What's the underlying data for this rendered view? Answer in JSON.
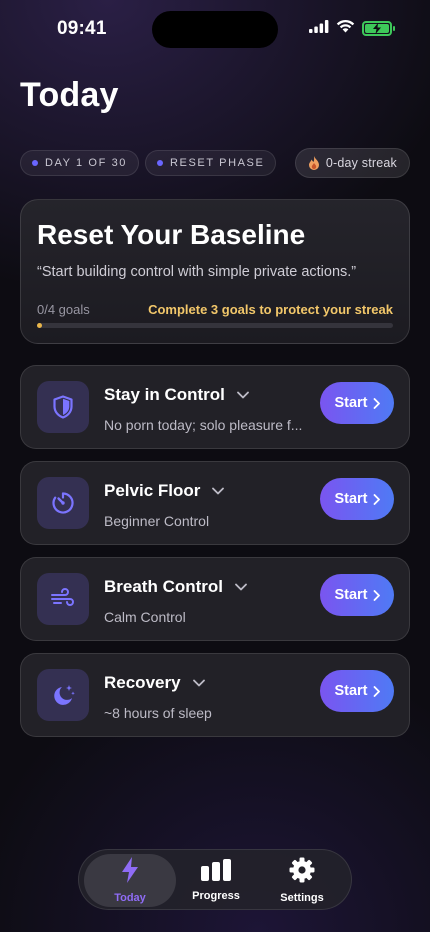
{
  "status_bar": {
    "time": "09:41"
  },
  "page_title": "Today",
  "chips": {
    "day": "DAY 1 OF 30",
    "phase": "RESET PHASE",
    "streak": "0-day streak"
  },
  "hero": {
    "title": "Reset Your Baseline",
    "quote": "“Start building control with simple private actions.”",
    "goals_label": "0/4 goals",
    "warning": "Complete 3 goals to protect your streak",
    "progress_fraction": 0.0
  },
  "tasks": [
    {
      "title": "Stay in Control",
      "subtitle": "No porn today; solo pleasure f...",
      "button": "Start",
      "icon": "shield-icon"
    },
    {
      "title": "Pelvic Floor",
      "subtitle": "Beginner Control",
      "button": "Start",
      "icon": "timer-icon"
    },
    {
      "title": "Breath Control",
      "subtitle": "Calm Control",
      "button": "Start",
      "icon": "wind-icon"
    },
    {
      "title": "Recovery",
      "subtitle": "~8 hours of sleep",
      "button": "Start",
      "icon": "moon-stars-icon"
    }
  ],
  "tabbar": {
    "items": [
      {
        "label": "Today",
        "icon": "bolt-icon",
        "active": true
      },
      {
        "label": "Progress",
        "icon": "bar-chart-icon",
        "active": false
      },
      {
        "label": "Settings",
        "icon": "gear-icon",
        "active": false
      }
    ]
  },
  "colors": {
    "accent_purple": "#8f6cf5",
    "button_gradient_start": "#7a55f0",
    "button_gradient_end": "#4f7af5",
    "warning_gold": "#f2c76a",
    "battery_green": "#3ec85a"
  }
}
